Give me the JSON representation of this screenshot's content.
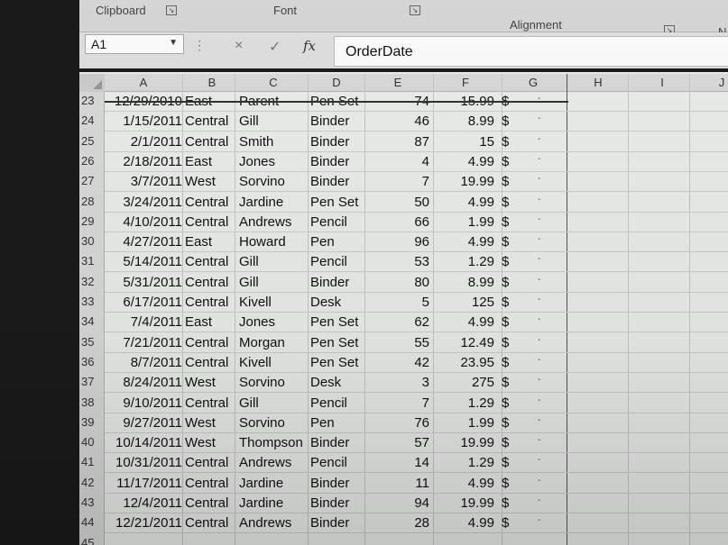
{
  "ribbon": {
    "clipboard_label": "Clipboard",
    "font_label": "Font",
    "alignment_label": "Alignment",
    "edge_label": "N"
  },
  "formula_bar": {
    "name_box": "A1",
    "cancel_icon": "×",
    "enter_icon": "✓",
    "fx_label": "fx",
    "value": "OrderDate"
  },
  "columns": [
    "A",
    "B",
    "C",
    "D",
    "E",
    "F",
    "G",
    "H",
    "I",
    "J"
  ],
  "rows": [
    {
      "n": "23",
      "a": "12/29/2010",
      "b": "East",
      "c": "Parent",
      "d": "Pen Set",
      "e": "74",
      "f": "15.99",
      "g": "$",
      "h": "-"
    },
    {
      "n": "24",
      "a": "1/15/2011",
      "b": "Central",
      "c": "Gill",
      "d": "Binder",
      "e": "46",
      "f": "8.99",
      "g": "$",
      "h": "-"
    },
    {
      "n": "25",
      "a": "2/1/2011",
      "b": "Central",
      "c": "Smith",
      "d": "Binder",
      "e": "87",
      "f": "15",
      "g": "$",
      "h": "-"
    },
    {
      "n": "26",
      "a": "2/18/2011",
      "b": "East",
      "c": "Jones",
      "d": "Binder",
      "e": "4",
      "f": "4.99",
      "g": "$",
      "h": "-"
    },
    {
      "n": "27",
      "a": "3/7/2011",
      "b": "West",
      "c": "Sorvino",
      "d": "Binder",
      "e": "7",
      "f": "19.99",
      "g": "$",
      "h": "-"
    },
    {
      "n": "28",
      "a": "3/24/2011",
      "b": "Central",
      "c": "Jardine",
      "d": "Pen Set",
      "e": "50",
      "f": "4.99",
      "g": "$",
      "h": "-"
    },
    {
      "n": "29",
      "a": "4/10/2011",
      "b": "Central",
      "c": "Andrews",
      "d": "Pencil",
      "e": "66",
      "f": "1.99",
      "g": "$",
      "h": "-"
    },
    {
      "n": "30",
      "a": "4/27/2011",
      "b": "East",
      "c": "Howard",
      "d": "Pen",
      "e": "96",
      "f": "4.99",
      "g": "$",
      "h": "-"
    },
    {
      "n": "31",
      "a": "5/14/2011",
      "b": "Central",
      "c": "Gill",
      "d": "Pencil",
      "e": "53",
      "f": "1.29",
      "g": "$",
      "h": "-"
    },
    {
      "n": "32",
      "a": "5/31/2011",
      "b": "Central",
      "c": "Gill",
      "d": "Binder",
      "e": "80",
      "f": "8.99",
      "g": "$",
      "h": "-"
    },
    {
      "n": "33",
      "a": "6/17/2011",
      "b": "Central",
      "c": "Kivell",
      "d": "Desk",
      "e": "5",
      "f": "125",
      "g": "$",
      "h": "-"
    },
    {
      "n": "34",
      "a": "7/4/2011",
      "b": "East",
      "c": "Jones",
      "d": "Pen Set",
      "e": "62",
      "f": "4.99",
      "g": "$",
      "h": "-"
    },
    {
      "n": "35",
      "a": "7/21/2011",
      "b": "Central",
      "c": "Morgan",
      "d": "Pen Set",
      "e": "55",
      "f": "12.49",
      "g": "$",
      "h": "-"
    },
    {
      "n": "36",
      "a": "8/7/2011",
      "b": "Central",
      "c": "Kivell",
      "d": "Pen Set",
      "e": "42",
      "f": "23.95",
      "g": "$",
      "h": "-"
    },
    {
      "n": "37",
      "a": "8/24/2011",
      "b": "West",
      "c": "Sorvino",
      "d": "Desk",
      "e": "3",
      "f": "275",
      "g": "$",
      "h": "-"
    },
    {
      "n": "38",
      "a": "9/10/2011",
      "b": "Central",
      "c": "Gill",
      "d": "Pencil",
      "e": "7",
      "f": "1.29",
      "g": "$",
      "h": "-"
    },
    {
      "n": "39",
      "a": "9/27/2011",
      "b": "West",
      "c": "Sorvino",
      "d": "Pen",
      "e": "76",
      "f": "1.99",
      "g": "$",
      "h": "-"
    },
    {
      "n": "40",
      "a": "10/14/2011",
      "b": "West",
      "c": "Thompson",
      "d": "Binder",
      "e": "57",
      "f": "19.99",
      "g": "$",
      "h": "-"
    },
    {
      "n": "41",
      "a": "10/31/2011",
      "b": "Central",
      "c": "Andrews",
      "d": "Pencil",
      "e": "14",
      "f": "1.29",
      "g": "$",
      "h": "-"
    },
    {
      "n": "42",
      "a": "11/17/2011",
      "b": "Central",
      "c": "Jardine",
      "d": "Binder",
      "e": "11",
      "f": "4.99",
      "g": "$",
      "h": "-"
    },
    {
      "n": "43",
      "a": "12/4/2011",
      "b": "Central",
      "c": "Jardine",
      "d": "Binder",
      "e": "94",
      "f": "19.99",
      "g": "$",
      "h": "-"
    },
    {
      "n": "44",
      "a": "12/21/2011",
      "b": "Central",
      "c": "Andrews",
      "d": "Binder",
      "e": "28",
      "f": "4.99",
      "g": "$",
      "h": "-"
    },
    {
      "n": "45",
      "a": "",
      "b": "",
      "c": "",
      "d": "",
      "e": "",
      "f": "",
      "g": "",
      "h": ""
    }
  ]
}
